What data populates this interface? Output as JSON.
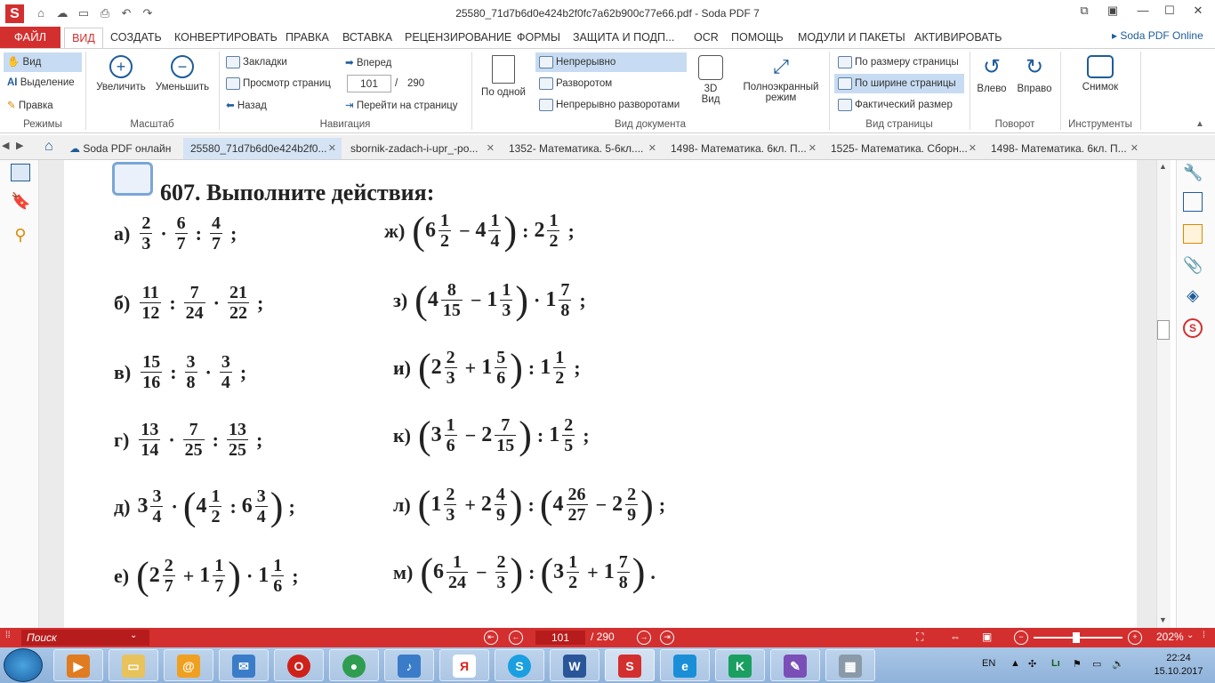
{
  "titlebar": {
    "logo": "S",
    "title": "25580_71d7b6d0e424b2f0fc7a62b900c77e66.pdf   -   Soda PDF 7",
    "quick_icons": [
      "home-icon",
      "cloud-icon",
      "open-folder-icon",
      "print-icon",
      "undo-icon",
      "redo-icon"
    ]
  },
  "menu": {
    "file": "ФАЙЛ",
    "items": [
      "ВИД",
      "СОЗДАТЬ",
      "КОНВЕРТИРОВАТЬ",
      "ПРАВКА",
      "ВСТАВКА",
      "РЕЦЕНЗИРОВАНИЕ",
      "ФОРМЫ",
      "ЗАЩИТА И ПОДП...",
      "OCR",
      "ПОМОЩЬ",
      "МОДУЛИ И ПАКЕТЫ",
      "АКТИВИРОВАТЬ"
    ],
    "online": "Soda PDF Online"
  },
  "ribbon": {
    "modes": {
      "label": "Режимы",
      "items": [
        "Вид",
        "Выделение",
        "Правка"
      ]
    },
    "zoom": {
      "label": "Масштаб",
      "in": "Увеличить",
      "out": "Уменьшить"
    },
    "nav": {
      "label": "Навигация",
      "bookmarks": "Закладки",
      "pages": "Просмотр страниц",
      "back": "Назад",
      "forward": "Вперед",
      "page": "101",
      "sep": "/",
      "total": "290",
      "goto": "Перейти на страницу"
    },
    "docview": {
      "label": "Вид документа",
      "single": "По одной",
      "continuous": "Непрерывно",
      "spread": "Разворотом",
      "cont_spread": "Непрерывно разворотами",
      "view3d": "3D Вид",
      "fullscreen": "Полноэкранный режим"
    },
    "pageview": {
      "label": "Вид страницы",
      "fit_page": "По размеру страницы",
      "fit_width": "По ширине страницы",
      "actual": "Фактический размер"
    },
    "rotate": {
      "label": "Поворот",
      "left": "Влево",
      "right": "Вправо"
    },
    "tools": {
      "label": "Инструменты",
      "snapshot": "Снимок"
    }
  },
  "tabs": [
    "Soda PDF онлайн",
    "25580_71d7b6d0e424b2f0...",
    "sbornik-zadach-i-upr_-po...",
    "1352- Математика. 5-6кл....",
    "1498- Математика. 6кл. П...",
    "1525- Математика. Сборн...",
    "1498- Математика. 6кл. П..."
  ],
  "doc": {
    "num": "607.",
    "title": "Выполните действия:",
    "a_lbl": "а)",
    "b_lbl": "б)",
    "v_lbl": "в)",
    "g_lbl": "г)",
    "d_lbl": "д)",
    "e_lbl": "е)",
    "zh_lbl": "ж)",
    "z_lbl": "з)",
    "i_lbl": "и)",
    "k_lbl": "к)",
    "l_lbl": "л)",
    "m_lbl": "м)"
  },
  "status": {
    "search": "Поиск",
    "page": "101",
    "total": "/ 290",
    "zoom": "202%"
  },
  "taskbar": {
    "lang": "EN",
    "time": "22:24",
    "date": "15.10.2017"
  },
  "colors": {
    "accent": "#d32f2f",
    "selected": "#c7dcf2",
    "taskbar": "#a9c6e6"
  }
}
